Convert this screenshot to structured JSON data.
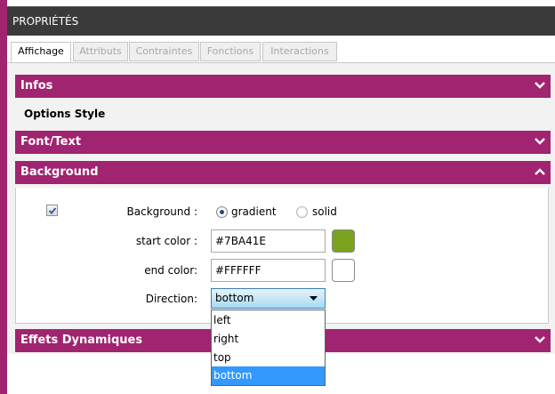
{
  "panel": {
    "title": "PROPRIÉTÉS"
  },
  "tabs": [
    {
      "label": "Affichage",
      "active": true
    },
    {
      "label": "Attributs",
      "active": false
    },
    {
      "label": "Contraintes",
      "active": false
    },
    {
      "label": "Fonctions",
      "active": false
    },
    {
      "label": "Interactions",
      "active": false
    }
  ],
  "sections": {
    "infos": {
      "label": "Infos",
      "expanded": false
    },
    "options_style": {
      "label": "Options Style"
    },
    "font_text": {
      "label": "Font/Text",
      "expanded": false
    },
    "background": {
      "label": "Background",
      "expanded": true
    },
    "effets": {
      "label": "Effets Dynamiques",
      "expanded": false
    }
  },
  "background_form": {
    "enabled": true,
    "background_label": "Background :",
    "radio_gradient": "gradient",
    "radio_solid": "solid",
    "mode": "gradient",
    "start_label": "start color :",
    "start_value": "#7BA41E",
    "end_label": "end color:",
    "end_value": "#FFFFFF",
    "direction_label": "Direction:",
    "direction_value": "bottom",
    "direction_options": [
      "left",
      "right",
      "top",
      "bottom"
    ]
  },
  "colors": {
    "accent": "#a0246f",
    "start_swatch": "#7BA41E",
    "end_swatch": "#FFFFFF",
    "highlight": "#3399ff"
  }
}
